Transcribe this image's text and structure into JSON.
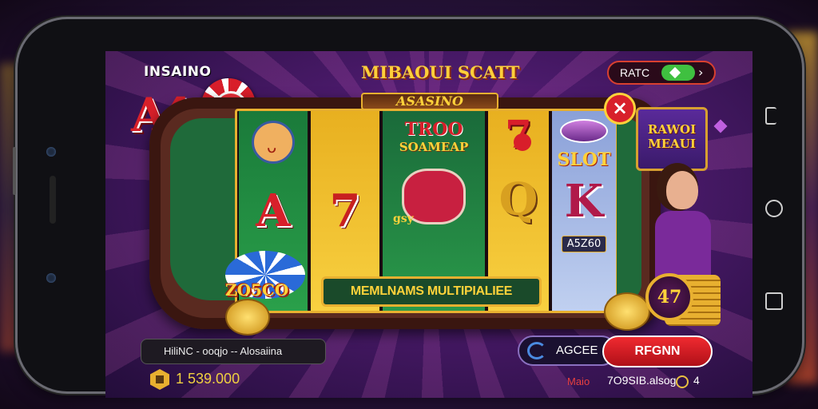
{
  "app": {
    "brand": "INSAINO",
    "logo_text": "A4",
    "title": "MIBAOUI SCATT"
  },
  "rate_toggle": {
    "label": "RATC",
    "state": "on",
    "color": "#3fc040"
  },
  "table": {
    "plaque": "ASASINO",
    "close_label": "×"
  },
  "reels": [
    {
      "symbol_top": "mascot",
      "letter": "A"
    },
    {
      "symbol_top": "seven",
      "letter": "7"
    },
    {
      "title": "TROO",
      "subtitle": "SOAMEAP",
      "center": "pig",
      "center_label": "gsy"
    },
    {
      "symbol_top": "seven-cherry",
      "letter": "Q"
    },
    {
      "title": "SLOT",
      "letter": "K",
      "value": "A5Z60"
    }
  ],
  "bonus_tile": {
    "line1": "RAWOI",
    "line2": "MEAUI"
  },
  "multiplier_banner": "MEMLNAMS MULTIPIALIEE",
  "chips": {
    "score": "ZO5CO"
  },
  "coin_badge": "47",
  "hud": {
    "info": "HiliNC - ooqjo -- Alosaiina",
    "balance": "1 539.000",
    "agee_label": "AGCEE",
    "spin_label": "RFGNN",
    "small_label": "Maio",
    "status": "7O9SIB.alsog",
    "count": "4"
  },
  "colors": {
    "accent": "#e8b030",
    "spin": "#d8202a",
    "felt": "#1f6a3a"
  }
}
